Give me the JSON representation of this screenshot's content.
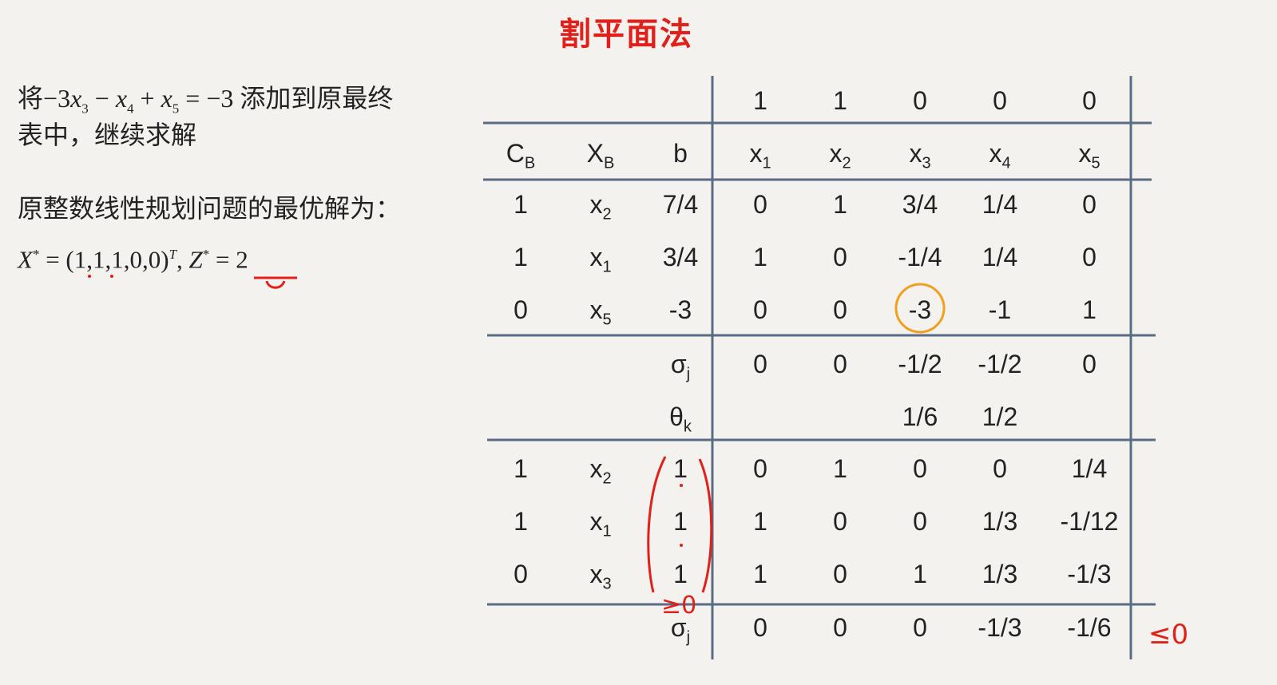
{
  "title": "割平面法",
  "left": {
    "line1_prefix": "将",
    "constraint_eq": "−3x₃ − x₄ + x₅ = −3",
    "line1_suffix": "添加到原最终",
    "line2": "表中，继续求解",
    "solution_label": "原整数线性规划问题的最优解为：",
    "solution": "X* = (1,1,1,0,0)ᵀ, Z* = 2"
  },
  "table": {
    "cj_row": [
      "1",
      "1",
      "0",
      "0",
      "0"
    ],
    "headers": [
      "C_B",
      "X_B",
      "b",
      "x1",
      "x2",
      "x3",
      "x4",
      "x5"
    ],
    "tableau1": [
      {
        "cb": "1",
        "xb": "x2",
        "b": "7/4",
        "vals": [
          "0",
          "1",
          "3/4",
          "1/4",
          "0"
        ]
      },
      {
        "cb": "1",
        "xb": "x1",
        "b": "3/4",
        "vals": [
          "1",
          "0",
          "-1/4",
          "1/4",
          "0"
        ]
      },
      {
        "cb": "0",
        "xb": "x5",
        "b": "-3",
        "vals": [
          "0",
          "0",
          "-3",
          "-1",
          "1"
        ]
      }
    ],
    "sigma1": {
      "label": "σj",
      "vals": [
        "0",
        "0",
        "-1/2",
        "-1/2",
        "0"
      ]
    },
    "theta": {
      "label": "θk",
      "vals": [
        "",
        "",
        "1/6",
        "1/2",
        ""
      ]
    },
    "tableau2": [
      {
        "cb": "1",
        "xb": "x2",
        "b": "1",
        "vals": [
          "0",
          "1",
          "0",
          "0",
          "1/4"
        ]
      },
      {
        "cb": "1",
        "xb": "x1",
        "b": "1",
        "vals": [
          "1",
          "0",
          "0",
          "1/3",
          "-1/12"
        ]
      },
      {
        "cb": "0",
        "xb": "x3",
        "b": "1",
        "vals": [
          "1",
          "0",
          "1",
          "1/3",
          "-1/3"
        ]
      }
    ],
    "sigma2": {
      "label": "σj",
      "vals": [
        "0",
        "0",
        "0",
        "-1/3",
        "-1/6"
      ]
    }
  },
  "annotations": {
    "b_nonneg": "≥0",
    "sigma_nonpos": "≤0"
  },
  "colors": {
    "title": "#e0201b",
    "ink": "#e0201b",
    "pivot_circle": "#f0a020",
    "grid": "#5a6b84"
  }
}
